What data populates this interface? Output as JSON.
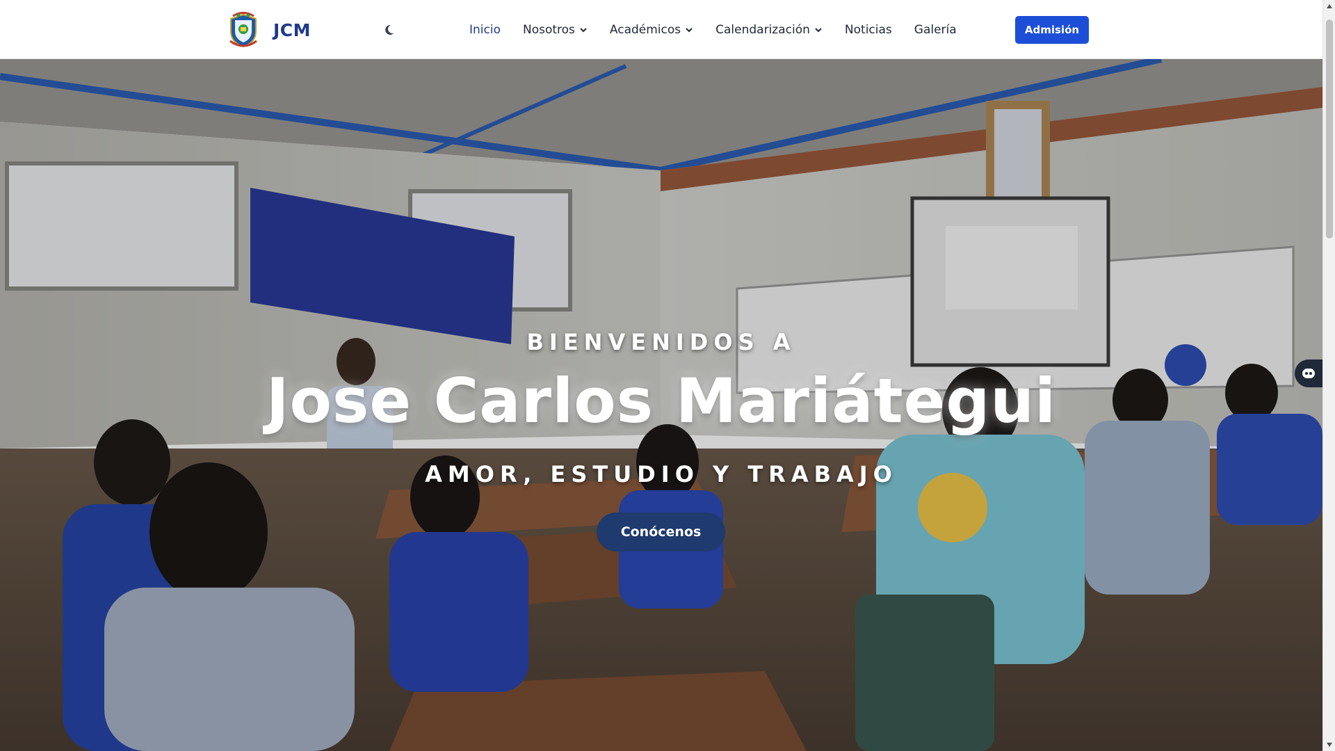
{
  "brand": {
    "name": "JCM",
    "logo_icon": "school-crest-icon"
  },
  "header": {
    "theme_toggle_icon": "moon-icon",
    "nav": [
      {
        "label": "Inicio",
        "active": true,
        "dropdown": false
      },
      {
        "label": "Nosotros",
        "active": false,
        "dropdown": true
      },
      {
        "label": "Académicos",
        "active": false,
        "dropdown": true
      },
      {
        "label": "Calendarización",
        "active": false,
        "dropdown": true
      },
      {
        "label": "Noticias",
        "active": false,
        "dropdown": false
      },
      {
        "label": "Galería",
        "active": false,
        "dropdown": false
      }
    ],
    "admission_label": "Admisión"
  },
  "hero": {
    "welcome": "BIENVENIDOS A",
    "title": "Jose Carlos Mariátegui",
    "motto": "AMOR, ESTUDIO Y TRABAJO",
    "cta_label": "Conócenos",
    "background": "classroom-photo"
  },
  "chat_widget": {
    "icon": "chatbot-icon"
  },
  "colors": {
    "brand_blue": "#1e3a8a",
    "admission_button": "#1d4ed8",
    "cta_button": "#1e3a6e"
  }
}
